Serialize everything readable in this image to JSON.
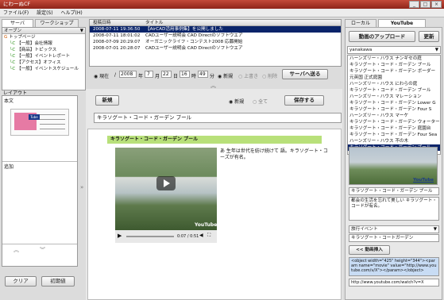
{
  "window": {
    "title": "にわーぬCF",
    "min": "_",
    "max": "□",
    "close": "×"
  },
  "menu": [
    "ファイル(F)",
    "設定(S)",
    "ヘルプ(H)"
  ],
  "left_tabs": [
    "サーバ",
    "ワークショップ"
  ],
  "tree": {
    "combo": "オーブン",
    "items": [
      "トップページ",
      "【一般】会社情報",
      "【商品】トピックス",
      "【一般】イベントレポート",
      "【アクセス】オフィス",
      "【一般】イベントスケジュール"
    ]
  },
  "list": {
    "headers": [
      "投稿日時",
      "タイトル"
    ],
    "rows": [
      {
        "date": "2008-07-11 19:36:50",
        "title": "【AirCAD活用事例集】を公開しました",
        "selected": true
      },
      {
        "date": "2008-07-11 18:01:02",
        "title": "CADユーザー説明会 CAD Directのソフトウエア"
      },
      {
        "date": "2008-07-09 20:29:07",
        "title": "オーガニックライフ・コンテスト2008 応募開始"
      },
      {
        "date": "2008-07-01 20:28:07",
        "title": "CADユーザー説明会 CAD Directのソフトウエア"
      }
    ]
  },
  "postbar": {
    "now": "現在",
    "slash": "/",
    "year": "2008",
    "year_u": "年",
    "month": "7",
    "month_u": "月",
    "day": "22",
    "day_u": "日",
    "hour": "16",
    "hour_u": "時",
    "min": "49",
    "min_u": "分",
    "new": "新規",
    "overwrite": "上書き",
    "delete": "削除",
    "send": "サーバへ送る"
  },
  "layout": {
    "label": "レイアウト",
    "body_label": "本文",
    "extra_label": "追加",
    "btn_clear": "クリア",
    "btn_save": "初期値"
  },
  "editor": {
    "new_btn": "新規",
    "radio_new": "新規",
    "radio_all": "全て",
    "save_btn": "保存する",
    "title_value": "キラソグート・コード・ガーデン プール",
    "article_title": "キラソグート・コード・ガーデン プール",
    "article_text": "あ 生年は世代を紡け続けて 語。キラソグート・コーズが有名。",
    "video_time": "0:07 / 0:51",
    "video_logo": "YouTube"
  },
  "right_tabs": [
    "ローカル",
    "YouTube"
  ],
  "youtube": {
    "upload_btn": "動画のアップロード",
    "update_btn": "更新",
    "combo": "yanakawa",
    "items": [
      "ハーンズリー・ハウス ナンギセの庭",
      "キラソグート・コード・ガーデン ブール",
      "キラソグート・コード・ガーデン ボーダー",
      "元英国 正式庭園",
      "ハーンズリー・ハウス にわらの庭",
      "キラソグート・コード・ガーデン ブール",
      "ハーンズリー・ハウス マレーション",
      "キラソグート・コード・ガーデン Lower G",
      "キラソグート・コード・ガーデン Four S",
      "ハーンズリー・ハウス マーケ",
      "キラソグート・コード・ガーデン ウォーター",
      "キラソグート・コード・ガーデン 庭園台",
      "キラソグート・コード・ガーデン Four Sea",
      "ハーンズリー・ハウス 不の木",
      "キラソグート・コード・ガーデン ブール"
    ],
    "selected_index": 14,
    "thumb_logo": "YouTube",
    "thumb_title": "キラソグート・コード・ガーデン プール",
    "description": "都会の生活を忘れて美しい キラソグート・コードが有名。",
    "tags_label": "旅行イベント",
    "tags_value": "キラソグート・コートガーデン",
    "insert_btn": "<< 動画挿入",
    "embed_code": "<object width=\"425\" height=\"344\"><param name=\"movie\" value=\"http://www.youtube.com/v/X\"></param></object>",
    "url_value": "http://www.youtube.com/watch?v=X"
  },
  "colors": {
    "title_red": "#a83222",
    "selection": "#0a246a",
    "article_head": "#b8e07a",
    "embed_bg": "#c8dcf4"
  }
}
